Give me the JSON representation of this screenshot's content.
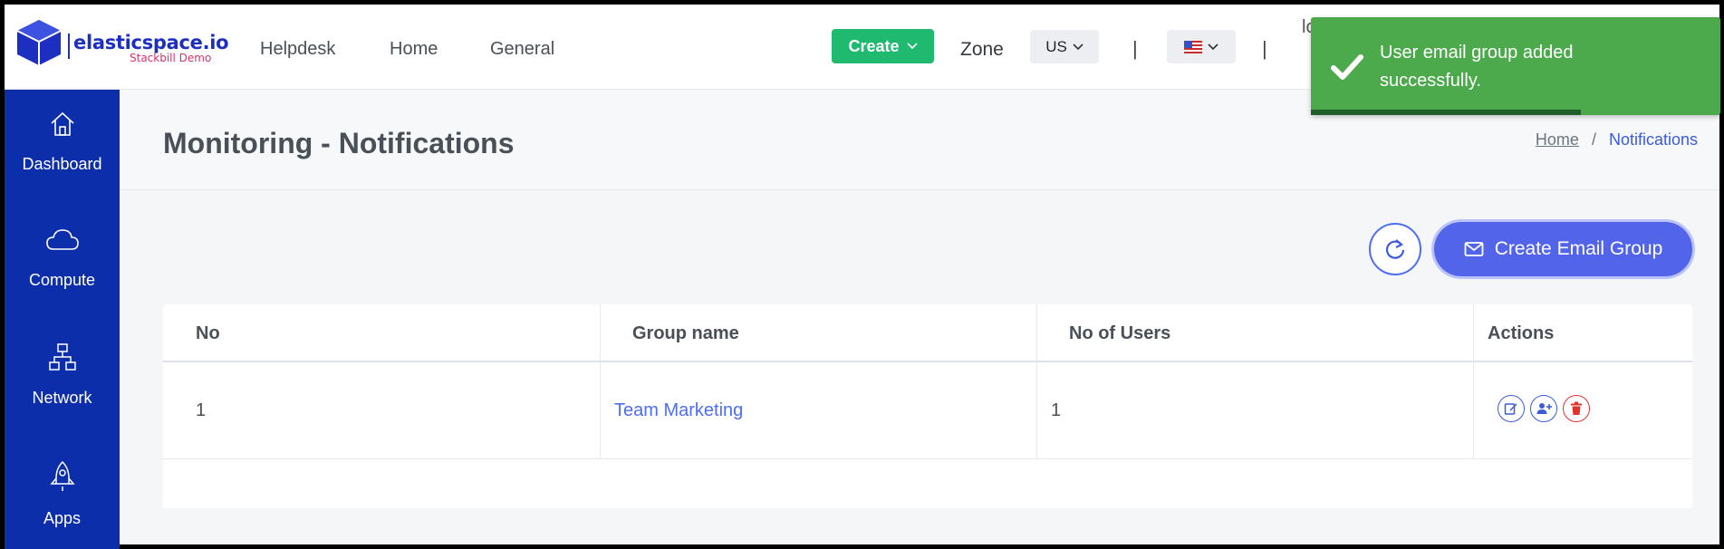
{
  "brand": {
    "name": "elasticspace.io",
    "subtitle": "Stackbill Demo",
    "color": "#1c2fc1"
  },
  "topnav": {
    "links": [
      "Helpdesk",
      "Home",
      "General"
    ],
    "create_label": "Create",
    "zone_label": "Zone",
    "zone_value": "US",
    "separator": "|",
    "user_partial": "lo"
  },
  "sidebar": {
    "items": [
      {
        "label": "Dashboard",
        "icon": "home-icon"
      },
      {
        "label": "Compute",
        "icon": "cloud-icon"
      },
      {
        "label": "Network",
        "icon": "network-icon"
      },
      {
        "label": "Apps",
        "icon": "rocket-icon"
      }
    ]
  },
  "page": {
    "title": "Monitoring - Notifications",
    "breadcrumb": {
      "home": "Home",
      "sep": "/",
      "current": "Notifications"
    }
  },
  "toolbar": {
    "create_email_group": "Create Email Group"
  },
  "table": {
    "headers": [
      "No",
      "Group name",
      "No of Users",
      "Actions"
    ],
    "rows": [
      {
        "no": "1",
        "group_name": "Team Marketing",
        "users": "1"
      }
    ]
  },
  "toast": {
    "message": "User email group added successfully.",
    "progress": 0.66,
    "color": "#4caa4c"
  }
}
